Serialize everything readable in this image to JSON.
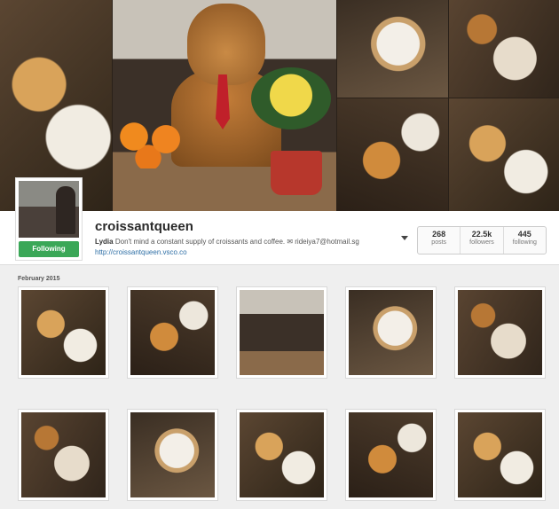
{
  "profile": {
    "username": "croissantqueen",
    "display_name": "Lydia",
    "bio": "Don't mind a constant supply of croissants and coffee. ✉ rideiya7@hotmail.sg",
    "website": "http://croissantqueen.vsco.co",
    "follow_label": "Following"
  },
  "stats": [
    {
      "value": "268",
      "label": "posts"
    },
    {
      "value": "22.5k",
      "label": "followers"
    },
    {
      "value": "445",
      "label": "following"
    }
  ],
  "grid": {
    "month_label": "February 2015"
  },
  "colors": {
    "following_button": "#3aa757",
    "link": "#2d6ea5"
  }
}
